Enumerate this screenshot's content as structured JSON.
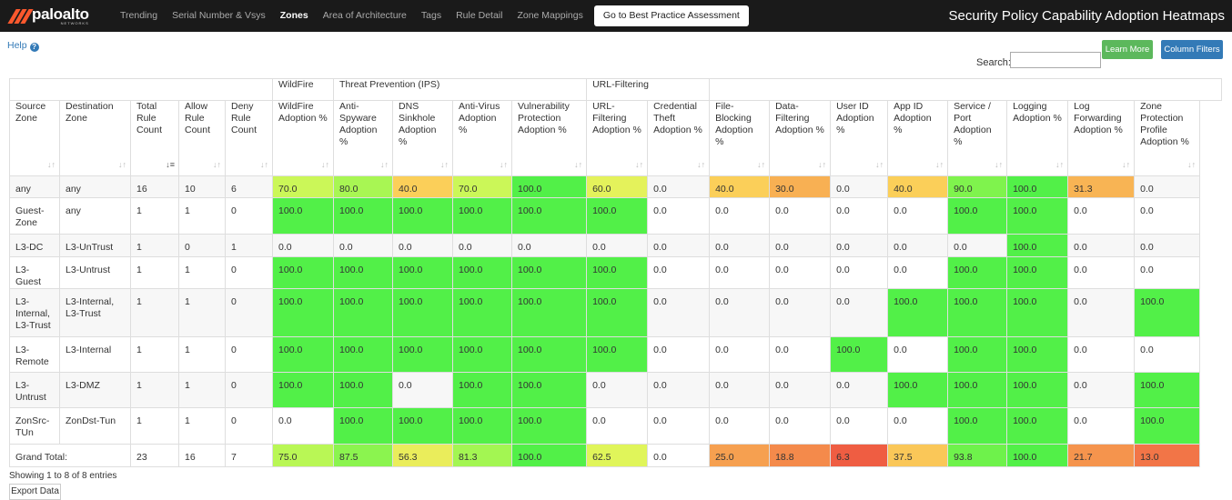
{
  "header": {
    "logo_text": "paloalto",
    "logo_sub": "NETWORKS",
    "app_title": "Security Policy Capability Adoption Heatmaps",
    "nav": [
      {
        "label": "Trending",
        "active": false
      },
      {
        "label": "Serial Number & Vsys",
        "active": false
      },
      {
        "label": "Zones",
        "active": true
      },
      {
        "label": "Area of Architecture",
        "active": false
      },
      {
        "label": "Tags",
        "active": false
      },
      {
        "label": "Rule Detail",
        "active": false
      },
      {
        "label": "Zone Mappings",
        "active": false
      }
    ],
    "cta_label": "Go to Best Practice Assessment"
  },
  "toolbar": {
    "help_label": "Help",
    "help_icon": "question-circle-icon",
    "learn_more_label": "Learn More",
    "column_filters_label": "Column Filters",
    "search_label": "Search:",
    "search_value": "",
    "search_placeholder": ""
  },
  "table": {
    "groups": [
      "WildFire",
      "Threat Prevention (IPS)",
      "URL-Filtering"
    ],
    "columns": [
      "Source Zone",
      "Destination Zone",
      "Total Rule Count",
      "Allow Rule Count",
      "Deny Rule Count",
      "WildFire Adoption %",
      "Anti-Spyware Adoption %",
      "DNS Sinkhole Adoption %",
      "Anti-Virus Adoption %",
      "Vulnerability Protection Adoption %",
      "URL-Filtering Adoption %",
      "Credential Theft Adoption %",
      "File-Blocking Adoption %",
      "Data-Filtering Adoption %",
      "User ID Adoption %",
      "App ID Adoption %",
      "Service / Port Adoption %",
      "Logging Adoption %",
      "Log Forwarding Adoption %",
      "Zone Protection Profile Adoption %"
    ],
    "rows": [
      [
        "any",
        "any",
        "16",
        "10",
        "6",
        "70.0",
        "80.0",
        "40.0",
        "70.0",
        "100.0",
        "60.0",
        "0.0",
        "40.0",
        "30.0",
        "0.0",
        "40.0",
        "90.0",
        "100.0",
        "31.3",
        "0.0"
      ],
      [
        "Guest-Zone",
        "any",
        "1",
        "1",
        "0",
        "100.0",
        "100.0",
        "100.0",
        "100.0",
        "100.0",
        "100.0",
        "0.0",
        "0.0",
        "0.0",
        "0.0",
        "0.0",
        "100.0",
        "100.0",
        "0.0",
        "0.0"
      ],
      [
        "L3-DC",
        "L3-UnTrust",
        "1",
        "0",
        "1",
        "0.0",
        "0.0",
        "0.0",
        "0.0",
        "0.0",
        "0.0",
        "0.0",
        "0.0",
        "0.0",
        "0.0",
        "0.0",
        "0.0",
        "100.0",
        "0.0",
        "0.0"
      ],
      [
        "L3-Guest",
        "L3-Untrust",
        "1",
        "1",
        "0",
        "100.0",
        "100.0",
        "100.0",
        "100.0",
        "100.0",
        "100.0",
        "0.0",
        "0.0",
        "0.0",
        "0.0",
        "0.0",
        "100.0",
        "100.0",
        "0.0",
        "0.0"
      ],
      [
        "L3-Internal, L3-Trust",
        "L3-Internal, L3-Trust",
        "1",
        "1",
        "0",
        "100.0",
        "100.0",
        "100.0",
        "100.0",
        "100.0",
        "100.0",
        "0.0",
        "0.0",
        "0.0",
        "0.0",
        "100.0",
        "100.0",
        "100.0",
        "0.0",
        "100.0"
      ],
      [
        "L3-Remote",
        "L3-Internal",
        "1",
        "1",
        "0",
        "100.0",
        "100.0",
        "100.0",
        "100.0",
        "100.0",
        "100.0",
        "0.0",
        "0.0",
        "0.0",
        "100.0",
        "0.0",
        "100.0",
        "100.0",
        "0.0",
        "0.0"
      ],
      [
        "L3-Untrust",
        "L3-DMZ",
        "1",
        "1",
        "0",
        "100.0",
        "100.0",
        "0.0",
        "100.0",
        "100.0",
        "0.0",
        "0.0",
        "0.0",
        "0.0",
        "0.0",
        "100.0",
        "100.0",
        "100.0",
        "0.0",
        "100.0"
      ],
      [
        "ZonSrc-TUn",
        "ZonDst-Tun",
        "1",
        "1",
        "0",
        "0.0",
        "100.0",
        "100.0",
        "100.0",
        "100.0",
        "0.0",
        "0.0",
        "0.0",
        "0.0",
        "0.0",
        "0.0",
        "100.0",
        "100.0",
        "0.0",
        "100.0"
      ]
    ],
    "total_label": "Grand Total:",
    "totals": [
      "23",
      "16",
      "7",
      "75.0",
      "87.5",
      "56.3",
      "81.3",
      "100.0",
      "62.5",
      "0.0",
      "25.0",
      "18.8",
      "6.3",
      "37.5",
      "93.8",
      "100.0",
      "21.7",
      "13.0"
    ]
  },
  "footer": {
    "info": "Showing 1 to 8 of 8 entries",
    "export_label": "Export Data"
  }
}
